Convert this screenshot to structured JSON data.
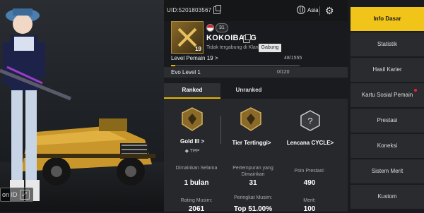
{
  "scene": {
    "zoom_label": "on ID"
  },
  "header": {
    "uid": "UID:5201803567",
    "region": "Asia"
  },
  "profile": {
    "avatar_level": "19",
    "name": "KOKOIBANG",
    "clan_text": "Tidak tergabung di Klan",
    "join_label": "Gabung",
    "rank_badge": "31",
    "level_label": "Level Pemain 19 >",
    "level_value": "48/1555",
    "level_progress": 0.031,
    "evo_label": "Evo Level 1",
    "evo_value": "0/120"
  },
  "tabs": [
    {
      "label": "Ranked",
      "active": true
    },
    {
      "label": "Unranked",
      "active": false
    }
  ],
  "tiers": [
    {
      "label": "Gold III >",
      "sub": "TPP"
    },
    {
      "label": "Tier Tertinggi>",
      "sub": ""
    },
    {
      "label": "Lencana CYCLE>",
      "sub": ""
    }
  ],
  "stats": [
    {
      "caption": "Dimainkan Selama",
      "value": "1 bulan"
    },
    {
      "caption": "Pertempuran yang Dimainkan",
      "value": "31"
    },
    {
      "caption": "Poin Prestasi:",
      "value": "490"
    },
    {
      "caption": "Rating Musim:",
      "value": "2061"
    },
    {
      "caption": "Peringkat Musim:",
      "value": "Top 51.00%"
    },
    {
      "caption": "Merit:",
      "value": "100"
    }
  ],
  "menu": [
    {
      "label": "Info Dasar",
      "active": true
    },
    {
      "label": "Statistik",
      "active": false
    },
    {
      "label": "Hasil Karier",
      "active": false
    },
    {
      "label": "Kartu Sosial Pemain",
      "active": false,
      "dot": true
    },
    {
      "label": "Prestasi",
      "active": false
    },
    {
      "label": "Koneksi",
      "active": false
    },
    {
      "label": "Sistem Merit",
      "active": false
    },
    {
      "label": "Kustom",
      "active": false
    }
  ],
  "colors": {
    "accent": "#f0c419",
    "progress": "#e8b400",
    "dot": "#e23"
  }
}
